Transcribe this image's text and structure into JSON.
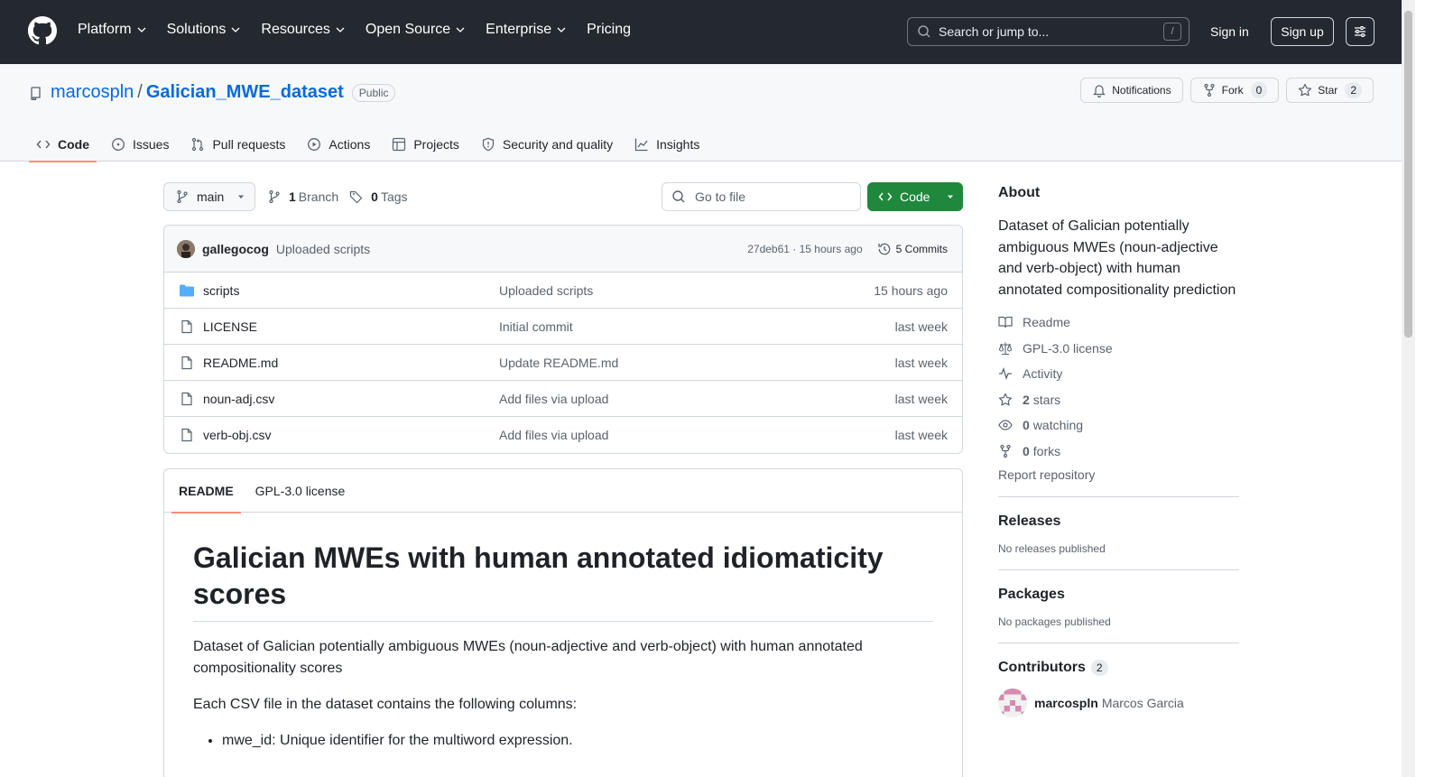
{
  "topnav": {
    "items": [
      "Platform",
      "Solutions",
      "Resources",
      "Open Source",
      "Enterprise",
      "Pricing"
    ],
    "search_placeholder": "Search or jump to...",
    "slash": "/",
    "signin": "Sign in",
    "signup": "Sign up"
  },
  "repo": {
    "owner": "marcospln",
    "separator": "/",
    "name": "Galician_MWE_dataset",
    "visibility": "Public",
    "notifications": "Notifications",
    "fork_label": "Fork",
    "fork_count": "0",
    "star_label": "Star",
    "star_count": "2",
    "tabs": [
      "Code",
      "Issues",
      "Pull requests",
      "Actions",
      "Projects",
      "Security and quality",
      "Insights"
    ]
  },
  "toolbar": {
    "branch": "main",
    "branch_count": "1",
    "branch_label": "Branch",
    "tag_count": "0",
    "tag_label": "Tags",
    "goto_file": "Go to file",
    "code_button": "Code"
  },
  "commit": {
    "author": "gallegocog",
    "message": "Uploaded scripts",
    "meta": "27deb61 · 15 hours ago",
    "commits": "5 Commits"
  },
  "files": [
    {
      "name": "scripts",
      "type": "folder",
      "message": "Uploaded scripts",
      "date": "15 hours ago"
    },
    {
      "name": "LICENSE",
      "type": "file",
      "message": "Initial commit",
      "date": "last week"
    },
    {
      "name": "README.md",
      "type": "file",
      "message": "Update README.md",
      "date": "last week"
    },
    {
      "name": "noun-adj.csv",
      "type": "file",
      "message": "Add files via upload",
      "date": "last week"
    },
    {
      "name": "verb-obj.csv",
      "type": "file",
      "message": "Add files via upload",
      "date": "last week"
    }
  ],
  "readme": {
    "tabs": [
      "README",
      "GPL-3.0 license"
    ],
    "title": "Galician MWEs with human annotated idiomaticity scores",
    "p1": "Dataset of Galician potentially ambiguous MWEs (noun-adjective and verb-object) with human annotated compositionality scores",
    "p2": "Each CSV file in the dataset contains the following columns:",
    "bullet1": "mwe_id: Unique identifier for the multiword expression."
  },
  "about": {
    "title": "About",
    "description": "Dataset of Galician potentially ambiguous MWEs (noun-adjective and verb-object) with human annotated compositionality prediction",
    "readme": "Readme",
    "license": "GPL-3.0 license",
    "activity": "Activity",
    "stars_count": "2",
    "stars_label": "stars",
    "watching_count": "0",
    "watching_label": "watching",
    "forks_count": "0",
    "forks_label": "forks",
    "report": "Report repository"
  },
  "releases": {
    "title": "Releases",
    "empty": "No releases published"
  },
  "packages": {
    "title": "Packages",
    "empty": "No packages published"
  },
  "contributors": {
    "title": "Contributors",
    "count": "2",
    "list": [
      {
        "login": "marcospln",
        "name": "Marcos Garcia"
      }
    ]
  },
  "colors": {
    "accent": "#0969da",
    "green": "#1f883d",
    "header": "#24292f",
    "tab_underline": "#fd8c73"
  }
}
